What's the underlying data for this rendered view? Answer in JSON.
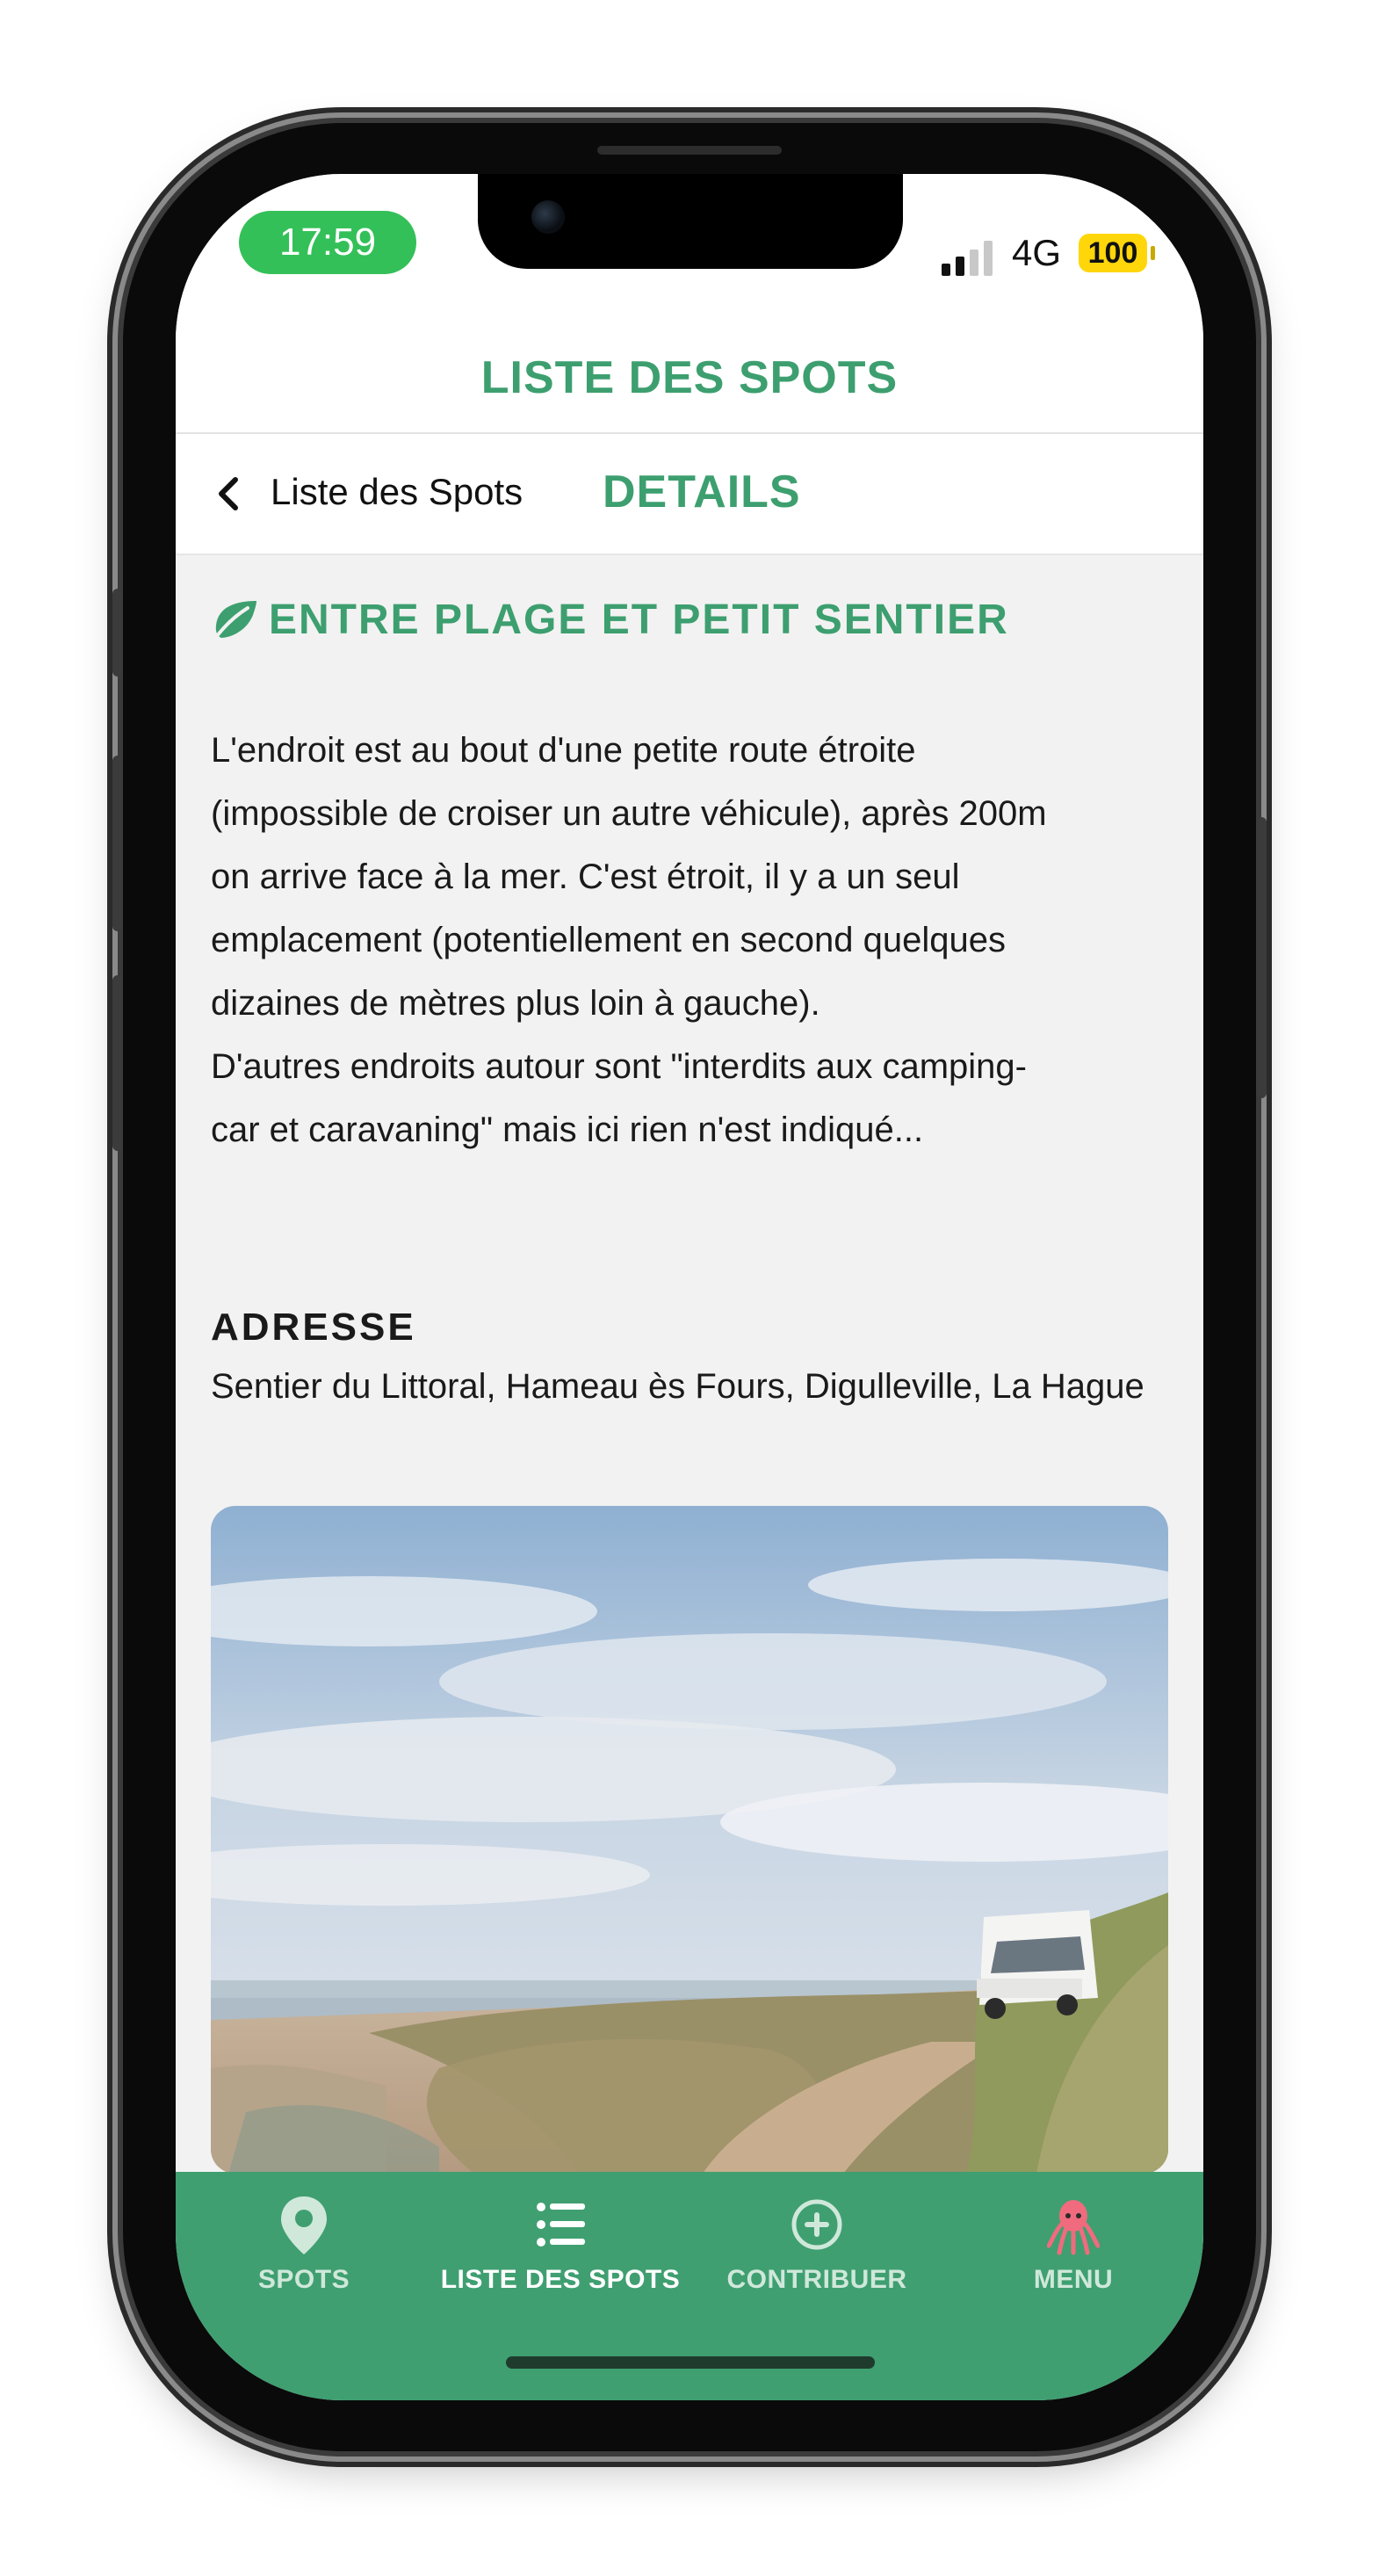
{
  "status_bar": {
    "time": "17:59",
    "network": "4G",
    "battery": "100"
  },
  "header": {
    "title": "LISTE DES SPOTS"
  },
  "navbar": {
    "back_label": "Liste des Spots",
    "title": "DETAILS"
  },
  "spot": {
    "title": "ENTRE PLAGE ET PETIT SENTIER",
    "description_lines": [
      "L'endroit est au bout d'une petite route étroite",
      "(impossible de croiser un autre véhicule), après 200m",
      "on arrive face à la mer. C'est étroit, il y a un seul",
      "emplacement (potentiellement en second quelques",
      "dizaines de mètres plus loin à gauche).",
      "D'autres endroits autour sont \"interdits aux camping-",
      "car et caravaning\" mais ici rien n'est indiqué..."
    ],
    "address_label": "ADRESSE",
    "address": "Sentier du Littoral, Hameau ès Fours, Digulleville, La Hague"
  },
  "tabs": [
    {
      "label": "SPOTS",
      "icon": "map-pin-icon",
      "active": false
    },
    {
      "label": "LISTE DES SPOTS",
      "icon": "list-icon",
      "active": true
    },
    {
      "label": "CONTRIBUER",
      "icon": "plus-circle-icon",
      "active": false
    },
    {
      "label": "MENU",
      "icon": "octopus-icon",
      "active": false
    }
  ],
  "colors": {
    "brand_green": "#3d9f6f",
    "tabbar_green": "#3f9f71",
    "time_pill": "#34c058",
    "battery": "#ffd60a"
  }
}
